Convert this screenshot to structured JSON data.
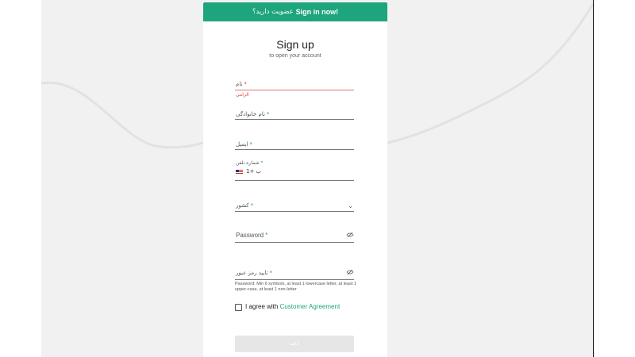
{
  "banner": {
    "question": "عضویت دارید؟",
    "link": "Sign in now!"
  },
  "header": {
    "title": "Sign up",
    "subtitle": "to open your account"
  },
  "fields": {
    "first_name": {
      "label": "نام",
      "required": "*",
      "error": "الزامی"
    },
    "last_name": {
      "label": "نام خانوادگی",
      "required": "*"
    },
    "email": {
      "label": "ایمیل",
      "required": "*"
    },
    "phone": {
      "label": "شماره تلفن",
      "required": "*",
      "country_code": "ب +1",
      "flag": "us-flag-icon"
    },
    "country": {
      "label": "کشور",
      "required": "*"
    },
    "password": {
      "label": "Password",
      "required": "*"
    },
    "confirm_password": {
      "label": "تایید رمز عبور",
      "required": "*"
    }
  },
  "password_hint": "Password: Min 6 symbols, at least 1 lowercase letter, at least 1 upper-case, at least 1 non-letter",
  "agreement": {
    "text": "I agree with ",
    "link": "Customer Agreement"
  },
  "submit_label": "ادامه",
  "icons": {
    "eye_off": "eye-off-icon",
    "chevron": "chevron-down-icon"
  },
  "colors": {
    "accent": "#1ea57d",
    "error": "#e53935",
    "background": "#f1f1f1",
    "button_disabled": "#e6e6e6"
  }
}
